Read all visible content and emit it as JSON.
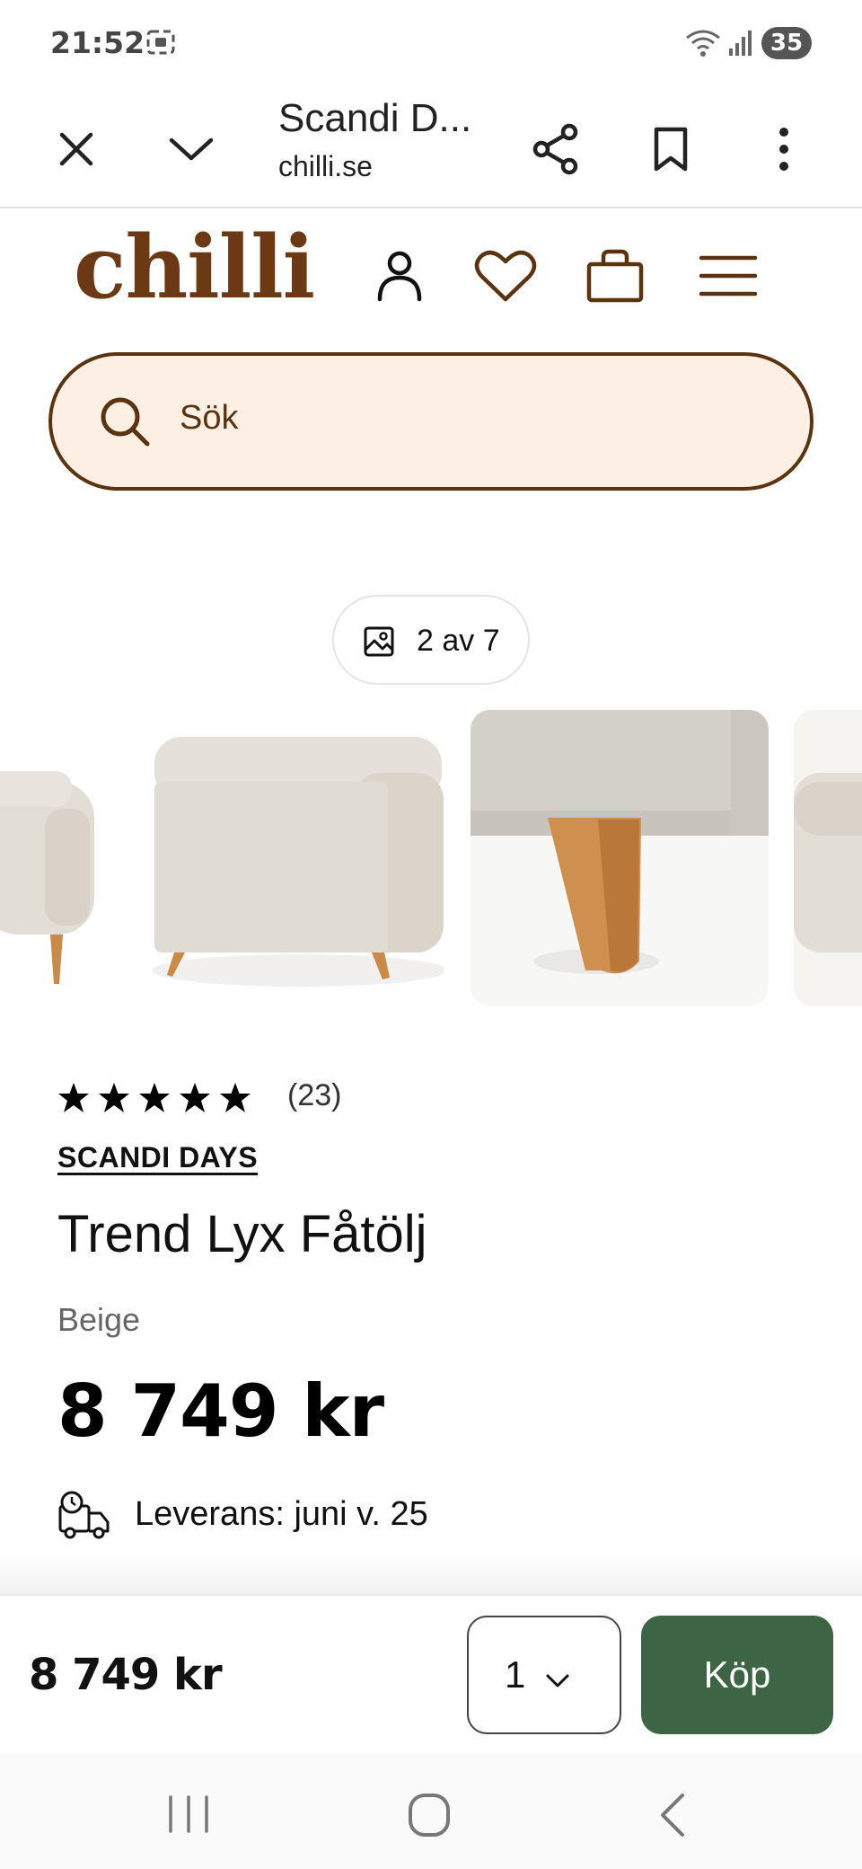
{
  "status_bar": {
    "time": "21:52",
    "battery": "35"
  },
  "browser": {
    "title": "Scandi D...",
    "url": "chilli.se"
  },
  "site": {
    "logo": "chilli",
    "search_placeholder": "Sök"
  },
  "gallery": {
    "counter": "2 av 7",
    "current_index": 2,
    "total": 7
  },
  "product": {
    "rating": 5,
    "rating_max": 5,
    "review_count": "(23)",
    "brand": "SCANDI DAYS",
    "name": "Trend Lyx Fåtölj",
    "color": "Beige",
    "price": "8 749 kr",
    "delivery": "Leverans: juni v. 25"
  },
  "buy_bar": {
    "price": "8 749 kr",
    "quantity": "1",
    "buy_label": "Köp"
  },
  "colors": {
    "brand_brown": "#6b3a14",
    "search_bg": "#fdefe4",
    "buy_green": "#3d6444"
  }
}
